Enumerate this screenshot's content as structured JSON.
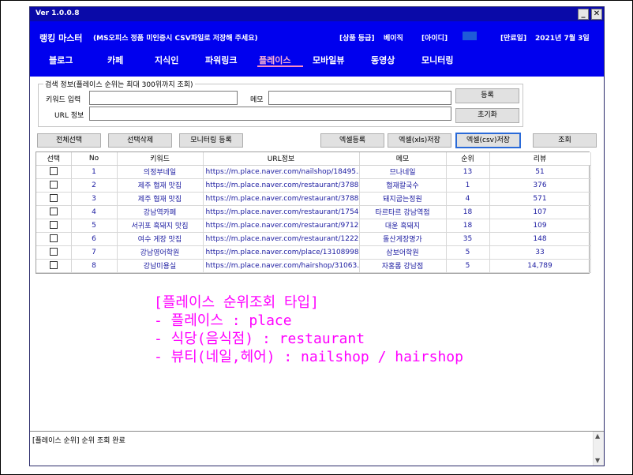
{
  "window": {
    "version": "Ver 1.0.0.8",
    "minimize_glyph": "_",
    "close_glyph": "✕"
  },
  "header": {
    "app_title": "랭킹 마스터",
    "app_subtitle": "(MS오피스 정품 미인증시 CSV파일로 저장해 주세요)",
    "grade_label": "[상품 등급]",
    "grade_value": "베이직",
    "id_label": "[아이디]",
    "expire_label": "[만료일]",
    "expire_value": "2021년 7월 3일",
    "brand_color": "#0000ee"
  },
  "menu": {
    "items": [
      {
        "label": "블로그"
      },
      {
        "label": "카페"
      },
      {
        "label": "지식인"
      },
      {
        "label": "파워링크"
      },
      {
        "label": "플레이스"
      },
      {
        "label": "모바일뷰"
      },
      {
        "label": "동영상"
      },
      {
        "label": "모니터링"
      }
    ],
    "active": "플레이스"
  },
  "search": {
    "group_title": "검색 정보(플레이스 순위는 최대 300위까지 조회)",
    "keyword_label": "키워드 입력",
    "keyword_value": "",
    "memo_label": "메모",
    "memo_value": "",
    "url_label": "URL 정보",
    "url_value": "",
    "register_button": "등록",
    "reset_button": "초기화"
  },
  "toolbar": {
    "select_all": "전체선택",
    "delete_selected": "선택삭제",
    "monitoring_register": "모니터링 등록",
    "excel_register": "엑셀등록",
    "excel_xls_save": "엑셀(xls)저장",
    "excel_csv_save": "엑셀(csv)저장",
    "query": "조회"
  },
  "table": {
    "columns": [
      "선택",
      "No",
      "키워드",
      "URL정보",
      "메모",
      "순위",
      "리뷰"
    ],
    "rows": [
      {
        "no": "1",
        "keyword": "의정부네일",
        "url": "https://m.place.naver.com/nailshop/18495...",
        "memo": "므나네일",
        "rank": "13",
        "review": "51"
      },
      {
        "no": "2",
        "keyword": "제주 협재 맛집",
        "url": "https://m.place.naver.com/restaurant/3788...",
        "memo": "협재칼국수",
        "rank": "1",
        "review": "376"
      },
      {
        "no": "3",
        "keyword": "제주 협재 맛집",
        "url": "https://m.place.naver.com/restaurant/3788...",
        "memo": "돼지굽는정원",
        "rank": "4",
        "review": "571"
      },
      {
        "no": "4",
        "keyword": "강남역카페",
        "url": "https://m.place.naver.com/restaurant/1754...",
        "memo": "타르타르 강남역점",
        "rank": "18",
        "review": "107"
      },
      {
        "no": "5",
        "keyword": "서귀포 흑돼지 맛집",
        "url": "https://m.place.naver.com/restaurant/9712...",
        "memo": "대윤 흑돼지",
        "rank": "18",
        "review": "109"
      },
      {
        "no": "6",
        "keyword": "여수 게장 맛집",
        "url": "https://m.place.naver.com/restaurant/1222...",
        "memo": "돌산게장명가",
        "rank": "35",
        "review": "148"
      },
      {
        "no": "7",
        "keyword": "강남영어학원",
        "url": "https://m.place.naver.com/place/13108998...",
        "memo": "삼보어학원",
        "rank": "5",
        "review": "33"
      },
      {
        "no": "8",
        "keyword": "강남미용실",
        "url": "https://m.place.naver.com/hairshop/31063...",
        "memo": "자홍롬 강남점",
        "rank": "5",
        "review": "14,789"
      }
    ]
  },
  "annotation": {
    "line1": "[플레이스 순위조회 타입]",
    "line2": "- 플레이스 : place",
    "line3": "- 식당(음식점) : restaurant",
    "line4": "- 뷰티(네일,헤어) : nailshop / hairshop",
    "color": "#ff00ff"
  },
  "log": {
    "message": "[플레이스 순위] 순위 조회 완료",
    "scroll_up": "▲",
    "scroll_down": "▼"
  }
}
